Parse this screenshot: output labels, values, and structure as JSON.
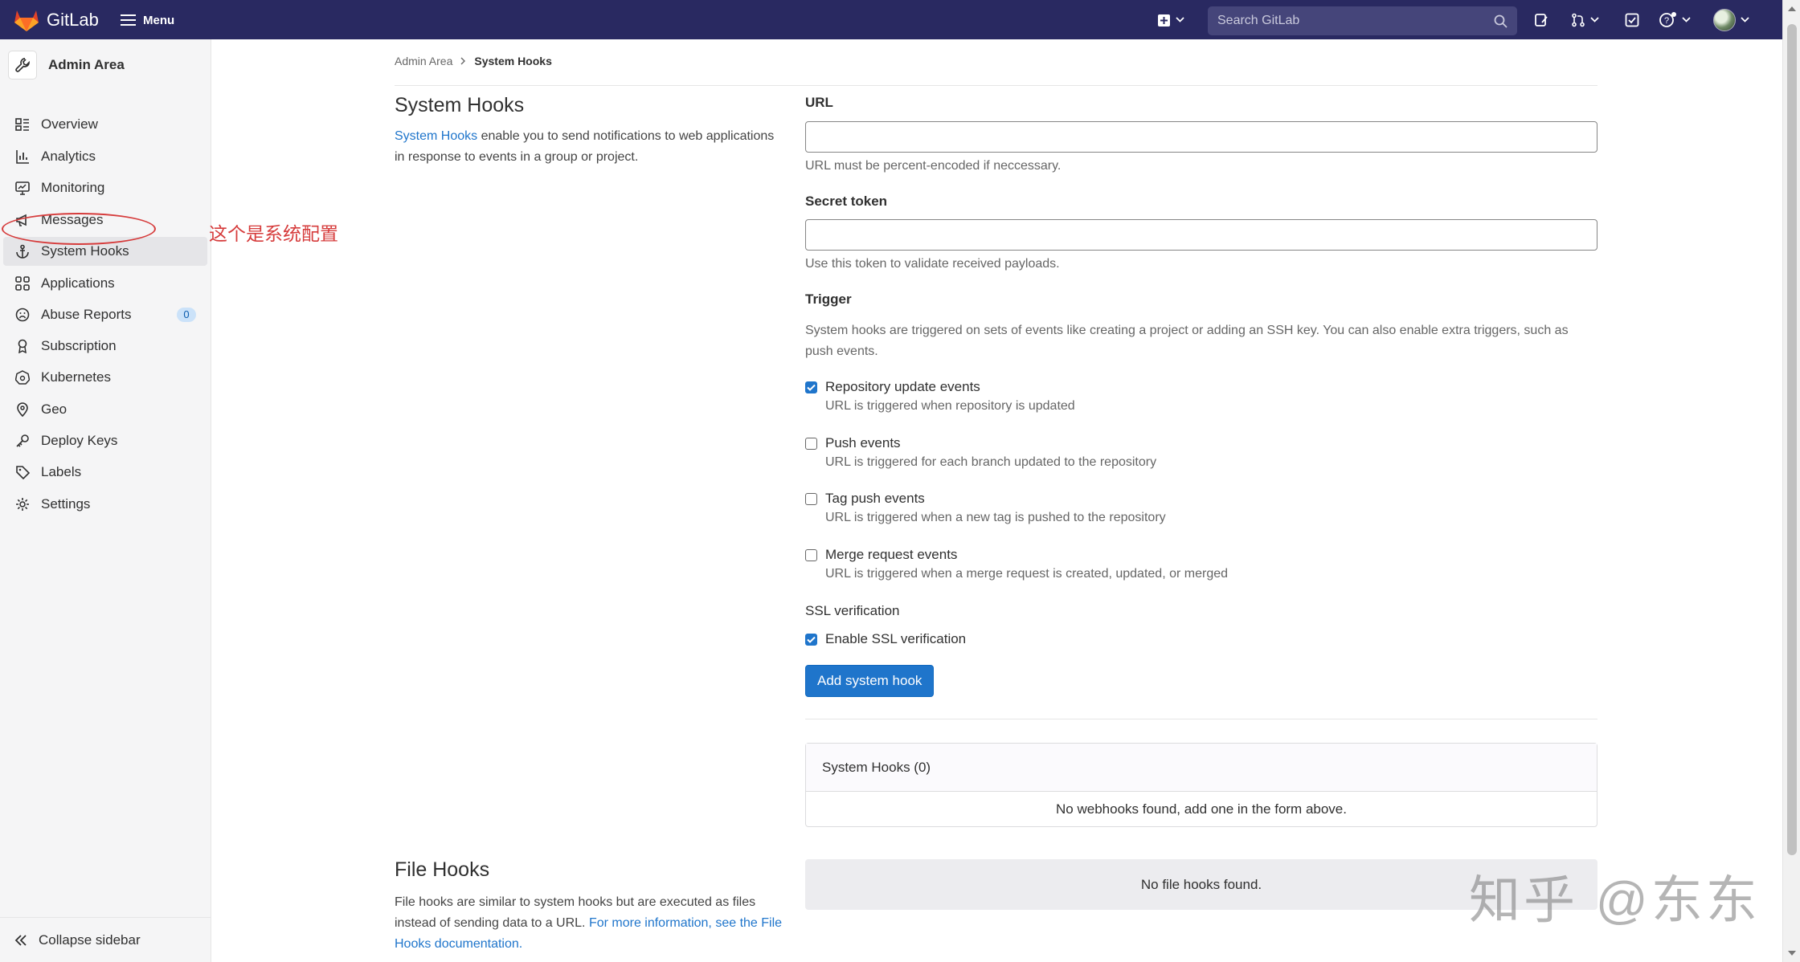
{
  "app": {
    "brand": "GitLab",
    "menu_label": "Menu"
  },
  "search": {
    "placeholder": "Search GitLab"
  },
  "sidebar": {
    "title": "Admin Area",
    "items": [
      {
        "label": "Overview",
        "icon": "overview-icon"
      },
      {
        "label": "Analytics",
        "icon": "chart-icon"
      },
      {
        "label": "Monitoring",
        "icon": "monitor-icon"
      },
      {
        "label": "Messages",
        "icon": "megaphone-icon"
      },
      {
        "label": "System Hooks",
        "icon": "anchor-icon",
        "active": true
      },
      {
        "label": "Applications",
        "icon": "applications-icon"
      },
      {
        "label": "Abuse Reports",
        "icon": "face-icon",
        "badge": "0"
      },
      {
        "label": "Subscription",
        "icon": "credit-card-icon"
      },
      {
        "label": "Kubernetes",
        "icon": "kubernetes-icon"
      },
      {
        "label": "Geo",
        "icon": "location-icon"
      },
      {
        "label": "Deploy Keys",
        "icon": "key-icon"
      },
      {
        "label": "Labels",
        "icon": "label-icon"
      },
      {
        "label": "Settings",
        "icon": "settings-icon"
      }
    ],
    "collapse_label": "Collapse sidebar"
  },
  "annotation": {
    "text": "这个是系统配置"
  },
  "breadcrumb": {
    "parent": "Admin Area",
    "current": "System Hooks"
  },
  "system_hooks": {
    "title": "System Hooks",
    "desc_link": "System Hooks",
    "desc_rest": " enable you to send notifications to web applications in response to events in a group or project."
  },
  "form": {
    "url_label": "URL",
    "url_value": "",
    "url_help": "URL must be percent-encoded if neccessary.",
    "token_label": "Secret token",
    "token_value": "",
    "token_help": "Use this token to validate received payloads.",
    "trigger_label": "Trigger",
    "trigger_help": "System hooks are triggered on sets of events like creating a project or adding an SSH key. You can also enable extra triggers, such as push events.",
    "triggers": [
      {
        "label": "Repository update events",
        "help": "URL is triggered when repository is updated",
        "checked": true
      },
      {
        "label": "Push events",
        "help": "URL is triggered for each branch updated to the repository",
        "checked": false
      },
      {
        "label": "Tag push events",
        "help": "URL is triggered when a new tag is pushed to the repository",
        "checked": false
      },
      {
        "label": "Merge request events",
        "help": "URL is triggered when a merge request is created, updated, or merged",
        "checked": false
      }
    ],
    "ssl_label": "SSL verification",
    "ssl_checkbox": "Enable SSL verification",
    "ssl_checked": true,
    "submit": "Add system hook"
  },
  "hooks_list": {
    "header": "System Hooks (0)",
    "empty": "No webhooks found, add one in the form above."
  },
  "file_hooks": {
    "title": "File Hooks",
    "desc_text": "File hooks are similar to system hooks but are executed as files instead of sending data to a URL. ",
    "desc_link": "For more information, see the File Hooks documentation.",
    "empty": "No file hooks found."
  },
  "watermark": "知乎 @东东",
  "colors": {
    "navbar": "#292961",
    "accent": "#1f75cb",
    "annotation": "#d63c3c"
  }
}
